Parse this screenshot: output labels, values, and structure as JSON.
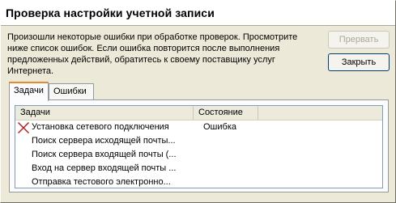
{
  "dialog": {
    "title": "Проверка настройки учетной записи",
    "message": "Произошли некоторые ошибки при обработке проверок. Просмотрите ниже список ошибок. Если ошибка повторится после выполнения предложенных действий, обратитесь к своему поставщику услуг Интернета.",
    "buttons": {
      "cancel": "Прервать",
      "close": "Закрыть"
    }
  },
  "tabs": [
    {
      "label": "Задачи",
      "active": true
    },
    {
      "label": "Ошибки",
      "active": false
    }
  ],
  "table": {
    "columns": [
      "Задачи",
      "Состояние"
    ],
    "rows": [
      {
        "task": "Установка сетевого подключения",
        "state": "Ошибка",
        "icon": "error-x-icon"
      },
      {
        "task": "Поиск сервера исходящей почты...",
        "state": "",
        "icon": ""
      },
      {
        "task": "Поиск сервера входящей почты (...",
        "state": "",
        "icon": ""
      },
      {
        "task": "Вход на сервер входящей почты ...",
        "state": "",
        "icon": ""
      },
      {
        "task": "Отправка тестового электронно...",
        "state": "",
        "icon": ""
      }
    ]
  },
  "colors": {
    "dialog_bg": "#ece9d8",
    "header_bg": "#ffffff",
    "error_x": "#b51a1a",
    "tab_accent": "#e68b2c"
  }
}
